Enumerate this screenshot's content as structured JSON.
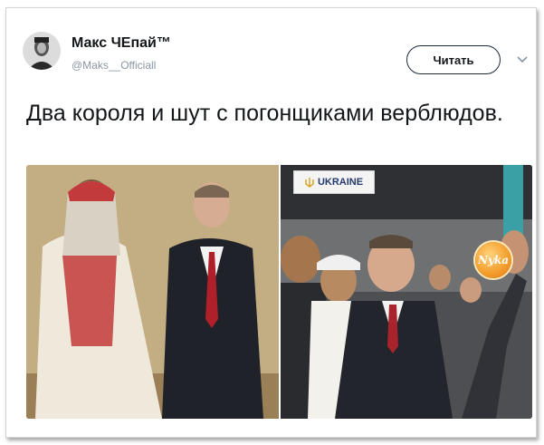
{
  "tweet": {
    "author_name": "Макс ЧЕпай™",
    "author_handle": "@Maks__Officiall",
    "follow_label": "Читать",
    "text": "Два короля и шут с погонщиками верблюдов."
  },
  "media": {
    "banner_text": "UKRAINE",
    "watermark_text": "Nyka"
  },
  "colors": {
    "text": "#14171a",
    "handle": "#8a96a3",
    "button_border": "#1b2a3a"
  }
}
